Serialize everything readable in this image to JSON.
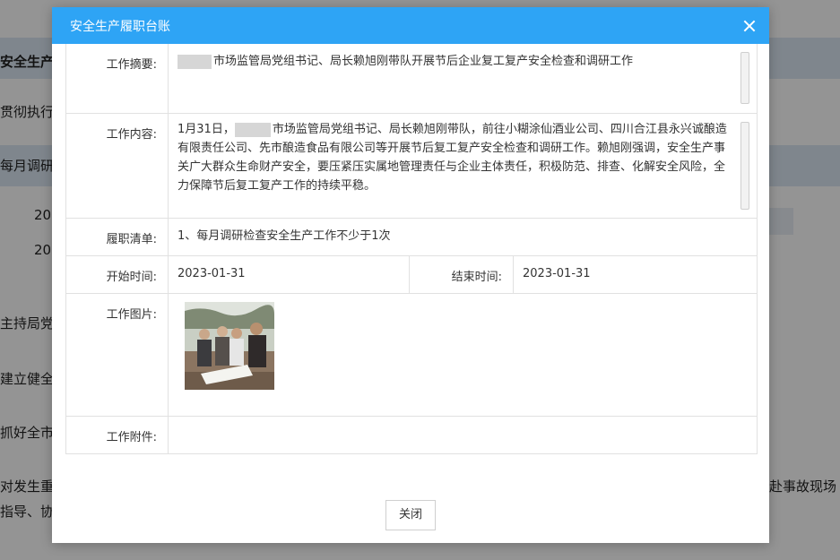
{
  "background": {
    "lines": [
      "安全生产",
      "贯彻执行",
      "每月调研",
      "20",
      "20",
      "主持局党",
      "建立健全",
      "抓好全市",
      "对发生重",
      "指导、协",
      "赶赴事故现场"
    ]
  },
  "dialog": {
    "title": "安全生产履职台账",
    "fields": {
      "summary": {
        "label": "工作摘要:",
        "value": "市场监管局党组书记、局长赖旭刚带队开展节后企业复工复产安全检查和调研工作"
      },
      "content": {
        "label": "工作内容:",
        "prefix": "1月31日，",
        "value": "市场监管局党组书记、局长赖旭刚带队，前往小糊涂仙酒业公司、四川合江县永兴诚酿造有限责任公司、先市酿造食品有限公司等开展节后复工复产安全检查和调研工作。赖旭刚强调，安全生产事关广大群众生命财产安全，要压紧压实属地管理责任与企业主体责任，积极防范、排查、化解安全风险，全力保障节后复工复产工作的持续平稳。"
      },
      "checklist": {
        "label": "履职清单:",
        "value": "1、每月调研检查安全生产工作不少于1次"
      },
      "start_time": {
        "label": "开始时间:",
        "value": "2023-01-31"
      },
      "end_time": {
        "label": "结束时间:",
        "value": "2023-01-31"
      },
      "photos": {
        "label": "工作图片:"
      },
      "attachments": {
        "label": "工作附件:",
        "value": ""
      }
    },
    "close_label": "关闭"
  },
  "colors": {
    "header": "#2ea4f5",
    "border": "#e1e1e1",
    "overlay": "rgba(0,0,0,0.42)"
  }
}
